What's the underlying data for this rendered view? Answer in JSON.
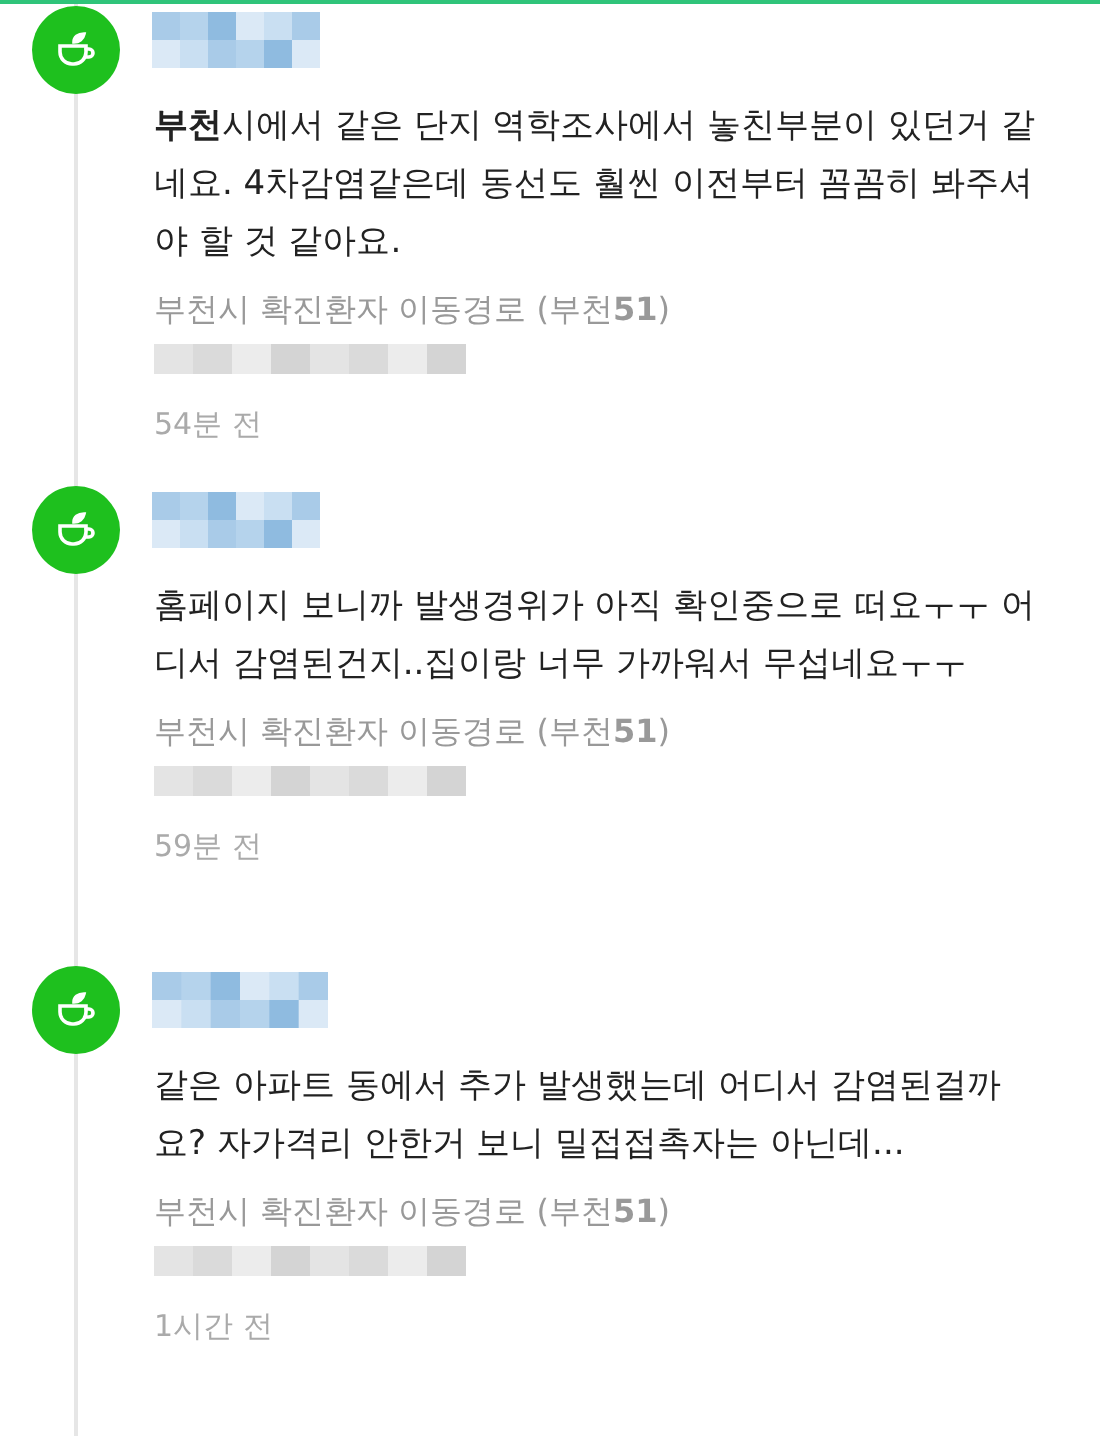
{
  "comments": [
    {
      "text": "**부천**시에서 같은 단지 역학조사에서 놓친부분이 있던거 같네요. 4차감염같은데 동선도 훨씬 이전부터 꼼꼼히 봐주셔야 할 것 같아요.",
      "source": "부천시 확진환자 이동경로 (부천**51**)",
      "time": "54분 전"
    },
    {
      "text": "홈페이지 보니까 발생경위가 아직 확인중으로 떠요ㅜㅜ 어디서 감염된건지..집이랑 너무 가까워서 무섭네요ㅜㅜ",
      "source": "부천시 확진환자 이동경로 (부천**51**)",
      "time": "59분 전"
    },
    {
      "text": "같은 아파트 동에서 추가 발생했는데 어디서 감염된걸까요? 자가격리 안한거 보니 밀접접촉자는 아닌데...",
      "source": "부천시 확진환자 이동경로 (부천**51**)",
      "time": "1시간 전"
    }
  ]
}
